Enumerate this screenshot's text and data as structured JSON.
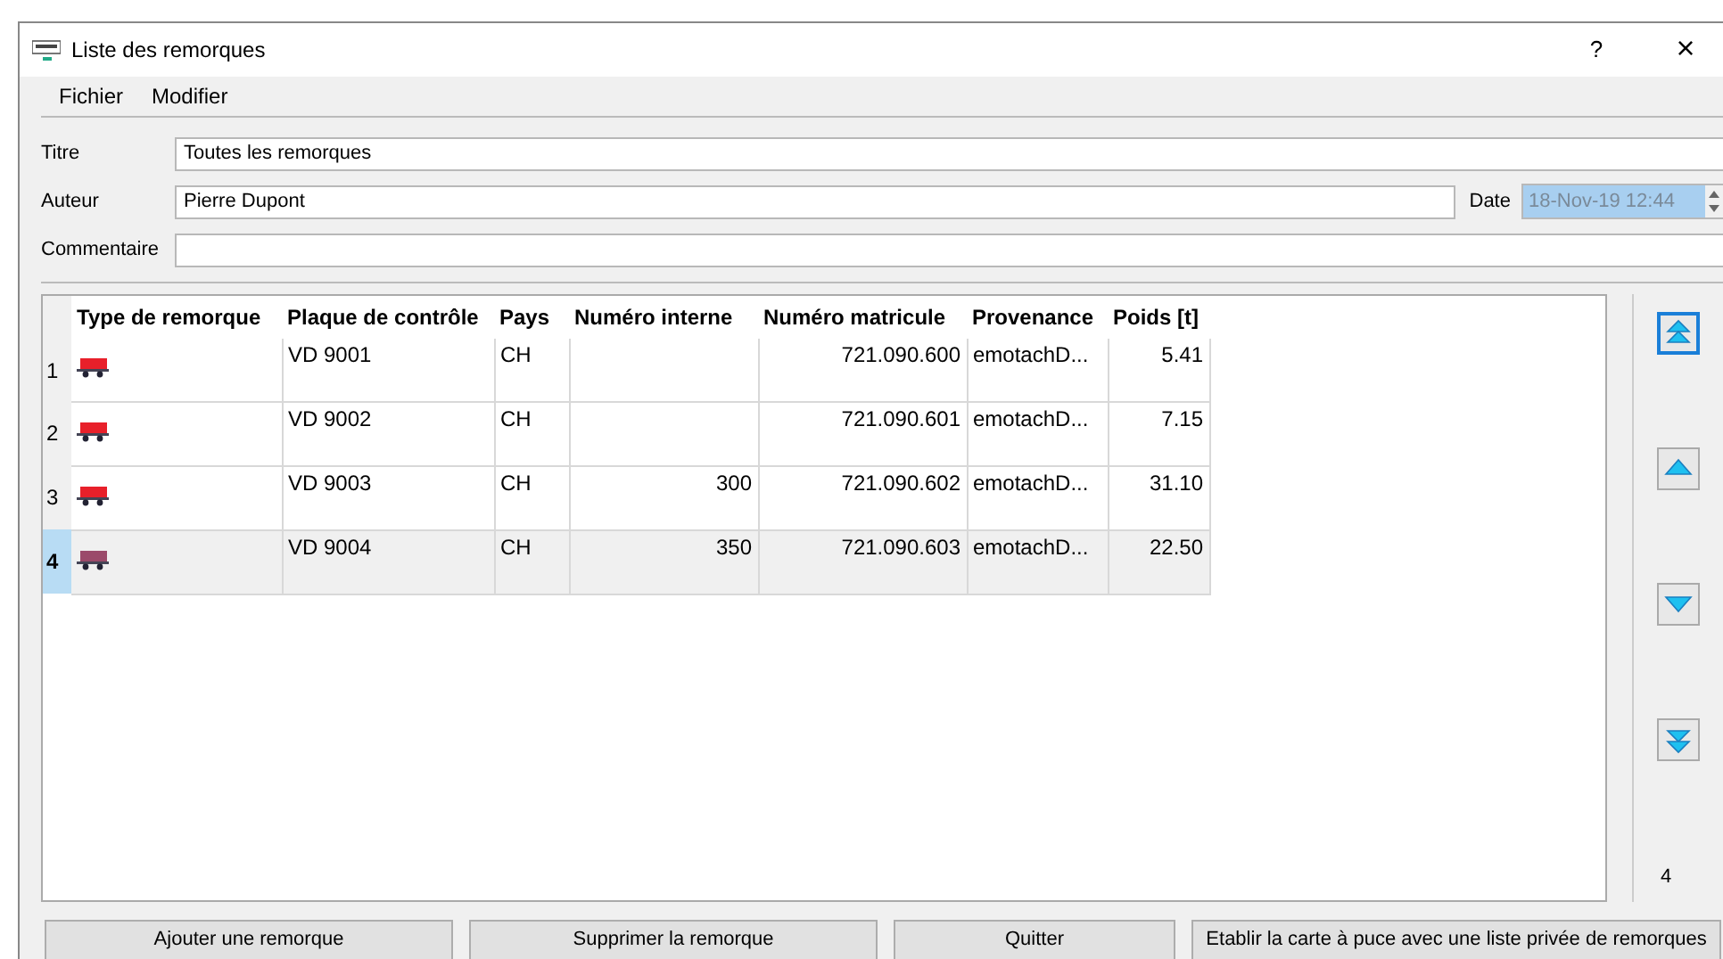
{
  "window": {
    "title": "Liste des remorques",
    "help": "?",
    "close": "×"
  },
  "menu": [
    "Fichier",
    "Modifier"
  ],
  "form": {
    "title_label": "Titre",
    "title_value": "Toutes les remorques",
    "author_label": "Auteur",
    "author_value": "Pierre Dupont",
    "date_label": "Date",
    "date_value": "18-Nov-19 12:44",
    "comment_label": "Commentaire"
  },
  "table": {
    "columns": [
      "Type de remorque",
      "Plaque de contrôle",
      "Pays",
      "Numéro interne",
      "Numéro matricule",
      "Provenance",
      "Poids [t]"
    ],
    "rows": [
      {
        "index": "1",
        "plate": "VD 9001",
        "country": "CH",
        "internal": "",
        "registration": "721.090.600",
        "origin": "emotachD...",
        "weight": "5.41",
        "selected": false
      },
      {
        "index": "2",
        "plate": "VD 9002",
        "country": "CH",
        "internal": "",
        "registration": "721.090.601",
        "origin": "emotachD...",
        "weight": "7.15",
        "selected": false
      },
      {
        "index": "3",
        "plate": "VD 9003",
        "country": "CH",
        "internal": "300",
        "registration": "721.090.602",
        "origin": "emotachD...",
        "weight": "31.10",
        "selected": false
      },
      {
        "index": "4",
        "plate": "VD 9004",
        "country": "CH",
        "internal": "350",
        "registration": "721.090.603",
        "origin": "emotachD...",
        "weight": "22.50",
        "selected": true
      }
    ]
  },
  "side": {
    "count": "4"
  },
  "buttons": [
    "Ajouter une remorque",
    "Supprimer la remorque",
    "Quitter",
    "Etablir la carte à puce avec une liste privée de remorques"
  ]
}
